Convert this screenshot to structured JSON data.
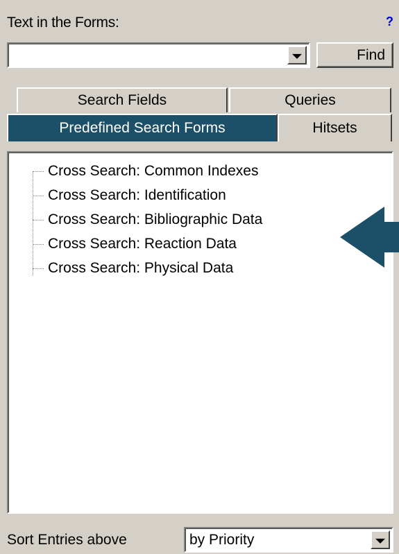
{
  "header": {
    "label": "Text in the Forms:",
    "help_glyph": "?"
  },
  "search": {
    "value": "",
    "find_label": "Find"
  },
  "tabs": {
    "search_fields": "Search Fields",
    "queries": "Queries",
    "predefined": "Predefined Search Forms",
    "hitsets": "Hitsets",
    "active": "Predefined Search Forms",
    "active_color": "#1b5068"
  },
  "tree": {
    "items": [
      {
        "label": "Cross Search: Common Indexes"
      },
      {
        "label": "Cross Search: Identification"
      },
      {
        "label": "Cross Search: Bibliographic Data"
      },
      {
        "label": "Cross Search: Reaction Data"
      },
      {
        "label": "Cross Search: Physical Data"
      }
    ]
  },
  "pointer": {
    "icon": "left-arrow-icon",
    "color": "#1b5068"
  },
  "sort": {
    "label": "Sort Entries above",
    "value": "by Priority"
  }
}
